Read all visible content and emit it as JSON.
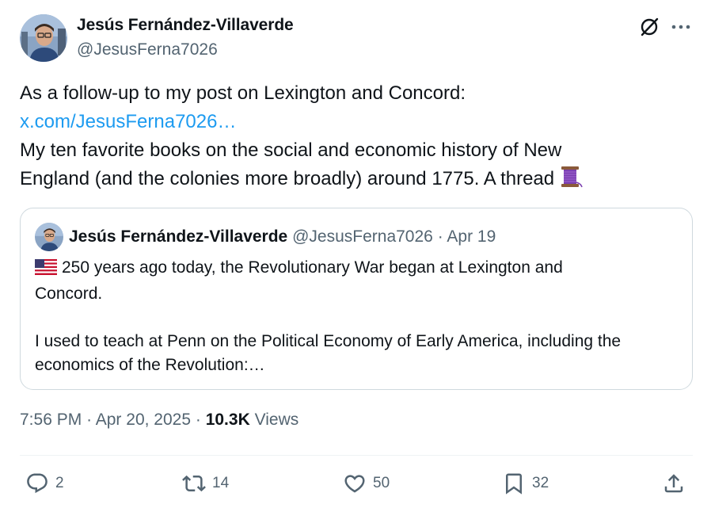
{
  "author": {
    "name": "Jesús Fernández-Villaverde",
    "handle": "@JesusFerna7026"
  },
  "header_icons": [
    "grok-icon",
    "more-icon"
  ],
  "tweet": {
    "line1": "As a follow-up to my post on Lexington and Concord:",
    "link": "x.com/JesusFerna7026…",
    "line3": "My ten favorite books on the social and economic history of New",
    "line4": "England (and the colonies more broadly) around 1775. A thread",
    "thread_icon": "thread-spool-icon"
  },
  "quote": {
    "name": "Jesús Fernández-Villaverde",
    "handle": "@JesusFerna7026",
    "separator": "·",
    "date": "Apr 19",
    "flag_icon": "us-flag-icon",
    "line1": "250 years ago today, the Revolutionary War began at Lexington and",
    "line2": "Concord.",
    "line3": "I used to teach at Penn on the Political Economy of Early America, including the",
    "line4": "economics of the Revolution:…"
  },
  "meta": {
    "time": "7:56 PM",
    "date": "Apr 20, 2025",
    "views_count": "10.3K",
    "views_label": "Views",
    "separator": "·"
  },
  "actions": {
    "replies": "2",
    "retweets": "14",
    "likes": "50",
    "bookmarks": "32"
  },
  "colors": {
    "text": "#0f1419",
    "muted": "#536471",
    "link": "#1d9bf0",
    "border": "#cfd9de"
  }
}
